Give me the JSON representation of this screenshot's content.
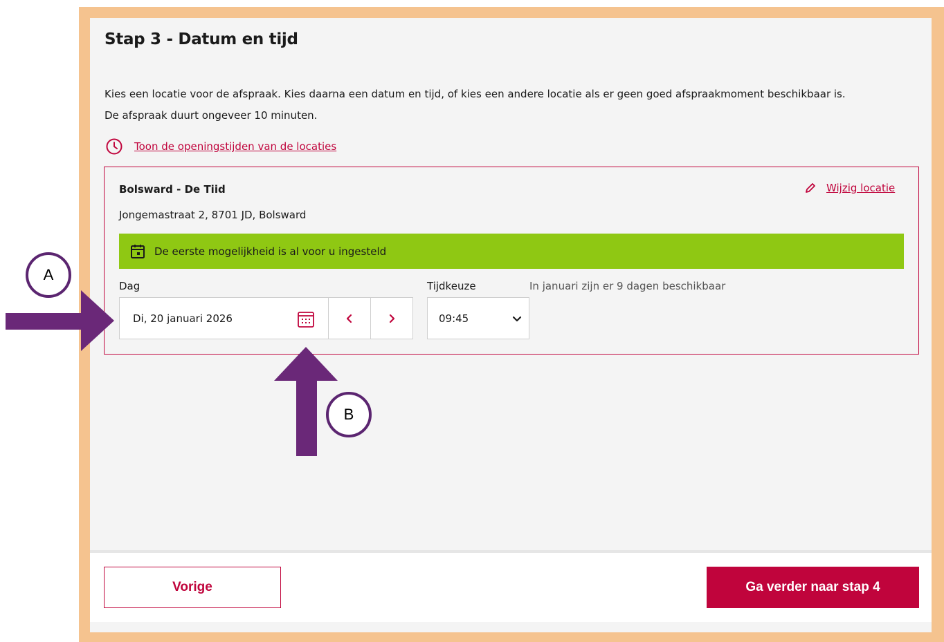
{
  "step": {
    "title": "Stap 3 - Datum en tijd",
    "intro_line1": "Kies een locatie voor de afspraak. Kies daarna een datum en tijd, of kies een andere locatie als er geen goed afspraakmoment beschikbaar is.",
    "intro_line2": "De afspraak duurt ongeveer 10 minuten.",
    "opening_hours_link": "Toon de openingstijden van de locaties"
  },
  "location": {
    "name": "Bolsward - De Tiid",
    "address": "Jongemastraat 2, 8701 JD, Bolsward",
    "change_link": "Wijzig locatie",
    "banner": "De eerste mogelijkheid is al voor u ingesteld"
  },
  "date_time": {
    "day_label": "Dag",
    "day_value": "Di, 20 januari 2026",
    "time_label": "Tijdkeuze",
    "time_value": "09:45",
    "availability": "In januari zijn er 9 dagen beschikbaar"
  },
  "footer": {
    "prev_label": "Vorige",
    "next_label": "Ga verder naar stap 4"
  },
  "annotations": {
    "a_label": "A",
    "b_label": "B"
  },
  "icons": {
    "hours": "clock-icon",
    "edit": "pencil-icon",
    "banner": "calendar-icon",
    "date_picker": "calendar-grid-icon",
    "prev_day": "chevron-left-icon",
    "next_day": "chevron-right-icon",
    "time_dropdown": "chevron-down-icon"
  },
  "colors": {
    "accent": "#c0043c",
    "banner_green": "#8fc813",
    "frame": "#f5c38f",
    "annotation_purple": "#6a2878"
  }
}
